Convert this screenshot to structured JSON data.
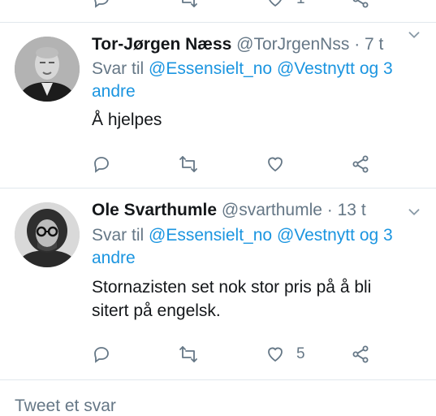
{
  "tweets": [
    {
      "name": "Tor-Jørgen Næss",
      "handle": "@TorJrgenNss",
      "separator": "·",
      "time": "7 t",
      "reply_prefix": "Svar til",
      "mention1": "@Essensielt_no",
      "mention2": "@Vestnytt",
      "reply_suffix_1": "og 3",
      "reply_suffix_2": "andre",
      "text_lines": [
        "Å hjelpes"
      ],
      "like_count": ""
    },
    {
      "name": "Ole Svarthumle",
      "handle": "@svarthumle",
      "separator": "·",
      "time": "13 t",
      "reply_prefix": "Svar til",
      "mention1": "@Essensielt_no",
      "mention2": "@Vestnytt",
      "reply_suffix_1": "og 3",
      "reply_suffix_2": "andre",
      "text_lines": [
        "Stornazisten set nok stor pris på å bli",
        "sitert på engelsk."
      ],
      "like_count": "5"
    }
  ],
  "top_actions": {
    "like_count": "1"
  },
  "footer": {
    "compose_placeholder": "Tweet et svar"
  },
  "icons": [
    "reply-icon",
    "retweet-icon",
    "like-icon",
    "share-icon",
    "chevron-down-icon"
  ],
  "colors": {
    "link": "#1b95e0",
    "muted": "#657786",
    "text": "#14171a",
    "divider": "#e1e8ed"
  }
}
